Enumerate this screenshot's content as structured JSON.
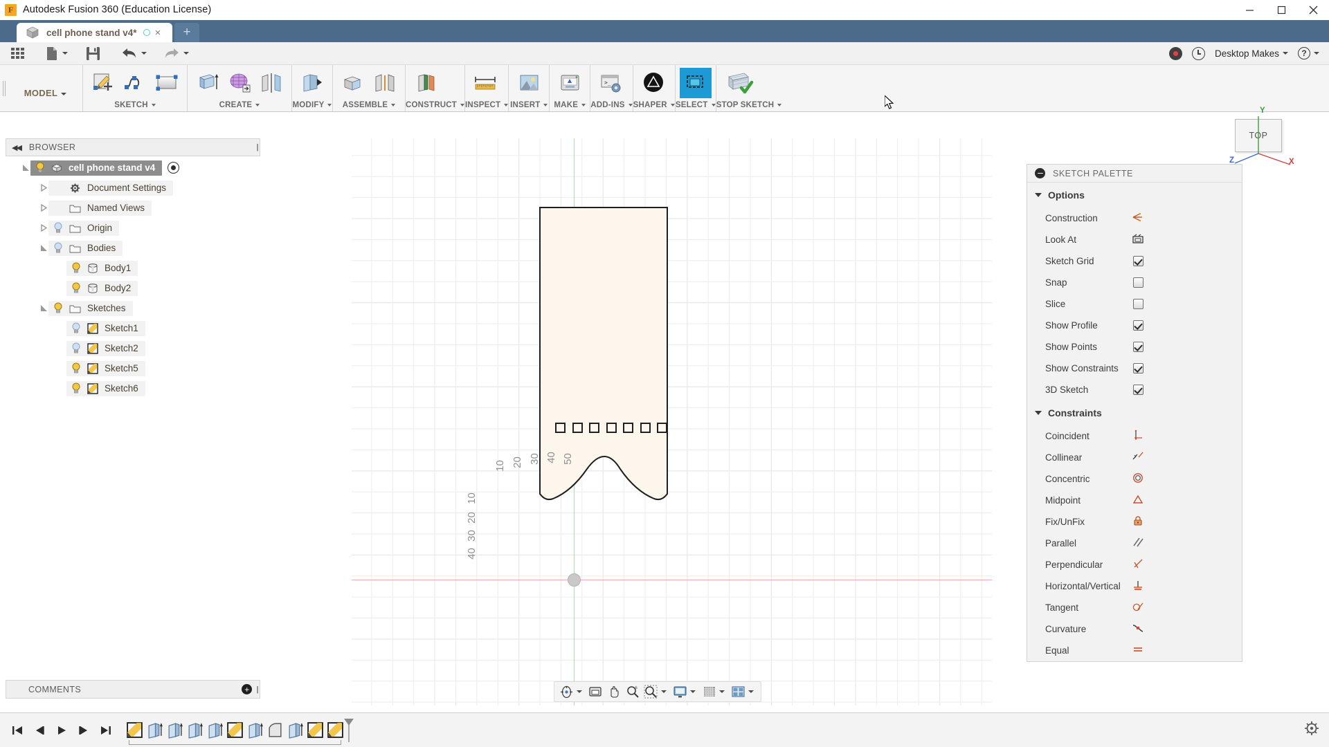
{
  "window": {
    "title": "Autodesk Fusion 360 (Education License)",
    "logo_letter": "F",
    "minimize": "minimize-icon",
    "maximize": "maximize-icon",
    "close": "close-icon"
  },
  "tabs": {
    "active_label": "cell phone stand v4*",
    "new_tab": "+",
    "close": "×"
  },
  "quick_access": {
    "grid_icon": "app-grid-icon",
    "new_icon": "new-document-icon",
    "save_icon": "save-icon",
    "undo_icon": "undo-icon",
    "redo_icon": "redo-icon",
    "record_icon": "record-icon",
    "history_icon": "history-clock-icon",
    "account_label": "Desktop Makes",
    "help_label": "?"
  },
  "ribbon": {
    "workspace": "MODEL",
    "groups": [
      {
        "label": "SKETCH",
        "has_caret": true,
        "icons": [
          "create-sketch-icon",
          "spline-icon",
          "rectangle-icon"
        ]
      },
      {
        "label": "CREATE",
        "has_caret": true,
        "icons": [
          "extrude-icon",
          "form-icon",
          "mirror-icon"
        ]
      },
      {
        "label": "MODIFY",
        "has_caret": true,
        "icons": [
          "press-pull-icon"
        ]
      },
      {
        "label": "ASSEMBLE",
        "has_caret": true,
        "icons": [
          "new-component-icon",
          "joint-icon"
        ]
      },
      {
        "label": "CONSTRUCT",
        "has_caret": true,
        "icons": [
          "offset-plane-icon"
        ]
      },
      {
        "label": "INSPECT",
        "has_caret": true,
        "icons": [
          "measure-icon"
        ]
      },
      {
        "label": "INSERT",
        "has_caret": true,
        "icons": [
          "insert-image-icon"
        ]
      },
      {
        "label": "MAKE",
        "has_caret": true,
        "icons": [
          "3d-print-icon"
        ]
      },
      {
        "label": "ADD-INS",
        "has_caret": true,
        "icons": [
          "scripts-addins-icon"
        ]
      },
      {
        "label": "SHAPER",
        "has_caret": true,
        "icons": [
          "shaper-icon"
        ]
      },
      {
        "label": "SELECT",
        "has_caret": true,
        "icons": [
          "select-icon"
        ]
      },
      {
        "label": "STOP SKETCH",
        "has_caret": true,
        "icons": [
          "stop-sketch-icon"
        ]
      }
    ]
  },
  "browser": {
    "header": "BROWSER",
    "items": [
      {
        "label": "cell phone stand v4",
        "indent": 0,
        "expander": "open",
        "bulb": true,
        "icon": "component-icon",
        "selected": true,
        "eye": true
      },
      {
        "label": "Document Settings",
        "indent": 1,
        "expander": "closed",
        "bulb": false,
        "icon": "gear-icon",
        "selected": false,
        "eye": false
      },
      {
        "label": "Named Views",
        "indent": 1,
        "expander": "closed",
        "bulb": false,
        "icon": "folder-icon",
        "selected": false,
        "eye": false
      },
      {
        "label": "Origin",
        "indent": 1,
        "expander": "closed",
        "bulb": "off",
        "icon": "folder-icon",
        "selected": false,
        "eye": false
      },
      {
        "label": "Bodies",
        "indent": 1,
        "expander": "open",
        "bulb": "off",
        "icon": "folder-icon",
        "selected": false,
        "eye": false
      },
      {
        "label": "Body1",
        "indent": 2,
        "expander": "none",
        "bulb": true,
        "icon": "body-icon",
        "selected": false,
        "eye": false
      },
      {
        "label": "Body2",
        "indent": 2,
        "expander": "none",
        "bulb": true,
        "icon": "body-icon",
        "selected": false,
        "eye": false
      },
      {
        "label": "Sketches",
        "indent": 1,
        "expander": "open",
        "bulb": true,
        "icon": "folder-icon",
        "selected": false,
        "eye": false
      },
      {
        "label": "Sketch1",
        "indent": 2,
        "expander": "none",
        "bulb": "off",
        "icon": "sketch-icon",
        "selected": false,
        "eye": false
      },
      {
        "label": "Sketch2",
        "indent": 2,
        "expander": "none",
        "bulb": "off",
        "icon": "sketch-icon",
        "selected": false,
        "eye": false
      },
      {
        "label": "Sketch5",
        "indent": 2,
        "expander": "none",
        "bulb": true,
        "icon": "sketch-icon",
        "selected": false,
        "eye": false
      },
      {
        "label": "Sketch6",
        "indent": 2,
        "expander": "none",
        "bulb": true,
        "icon": "sketch-icon",
        "selected": false,
        "eye": false
      }
    ]
  },
  "comments": {
    "title": "COMMENTS",
    "add_icon": "add-comment-icon"
  },
  "viewcube": {
    "face_label": "TOP",
    "axis_x": "X",
    "axis_y": "Y",
    "axis_z": "Z"
  },
  "canvas": {
    "dimension_labels": [
      "10",
      "20",
      "30",
      "40",
      "50"
    ],
    "vertical_dimension_labels": [
      "10",
      "20",
      "30",
      "40"
    ],
    "hole_count": 7,
    "colors": {
      "profile_fill": "#fdf6ec",
      "profile_stroke": "#1f1f1f",
      "x_axis": "#f0a8a8",
      "y_axis": "#a8dfa8"
    }
  },
  "navbar": {
    "buttons": [
      "orbit-icon",
      "pan-icon",
      "zoom-icon",
      "zoom-window-icon",
      "display-settings-icon",
      "grid-snaps-icon",
      "viewports-icon"
    ]
  },
  "timeline": {
    "playback": [
      "jump-to-start-icon",
      "step-back-icon",
      "play-icon",
      "step-forward-icon",
      "jump-to-end-icon"
    ],
    "features": [
      "sketch-feature-icon",
      "extrude-feature-icon",
      "extrude-feature-icon",
      "extrude-feature-icon",
      "extrude-feature-icon",
      "sketch-feature-icon",
      "extrude-feature-icon",
      "fillet-feature-icon",
      "extrude-feature-icon",
      "sketch-feature-icon",
      "sketch-feature-icon"
    ],
    "settings_icon": "settings-gear-icon"
  },
  "sketch_palette": {
    "header": "SKETCH PALETTE",
    "sections": [
      {
        "title": "Options",
        "rows": [
          {
            "label": "Construction",
            "control": "icon",
            "icon": "construction-icon"
          },
          {
            "label": "Look At",
            "control": "icon",
            "icon": "look-at-icon"
          },
          {
            "label": "Sketch Grid",
            "control": "checkbox",
            "checked": true
          },
          {
            "label": "Snap",
            "control": "checkbox",
            "checked": false
          },
          {
            "label": "Slice",
            "control": "checkbox",
            "checked": false
          },
          {
            "label": "Show Profile",
            "control": "checkbox",
            "checked": true
          },
          {
            "label": "Show Points",
            "control": "checkbox",
            "checked": true
          },
          {
            "label": "Show Constraints",
            "control": "checkbox",
            "checked": true
          },
          {
            "label": "3D Sketch",
            "control": "checkbox",
            "checked": true
          }
        ]
      },
      {
        "title": "Constraints",
        "rows": [
          {
            "label": "Coincident",
            "control": "icon",
            "icon": "coincident-constraint-icon"
          },
          {
            "label": "Collinear",
            "control": "icon",
            "icon": "collinear-constraint-icon"
          },
          {
            "label": "Concentric",
            "control": "icon",
            "icon": "concentric-constraint-icon"
          },
          {
            "label": "Midpoint",
            "control": "icon",
            "icon": "midpoint-constraint-icon"
          },
          {
            "label": "Fix/UnFix",
            "control": "icon",
            "icon": "fix-unfix-constraint-icon"
          },
          {
            "label": "Parallel",
            "control": "icon",
            "icon": "parallel-constraint-icon"
          },
          {
            "label": "Perpendicular",
            "control": "icon",
            "icon": "perpendicular-constraint-icon"
          },
          {
            "label": "Horizontal/Vertical",
            "control": "icon",
            "icon": "horizontal-vertical-constraint-icon"
          },
          {
            "label": "Tangent",
            "control": "icon",
            "icon": "tangent-constraint-icon"
          },
          {
            "label": "Curvature",
            "control": "icon",
            "icon": "curvature-constraint-icon"
          },
          {
            "label": "Equal",
            "control": "icon",
            "icon": "equal-constraint-icon"
          }
        ]
      }
    ]
  }
}
